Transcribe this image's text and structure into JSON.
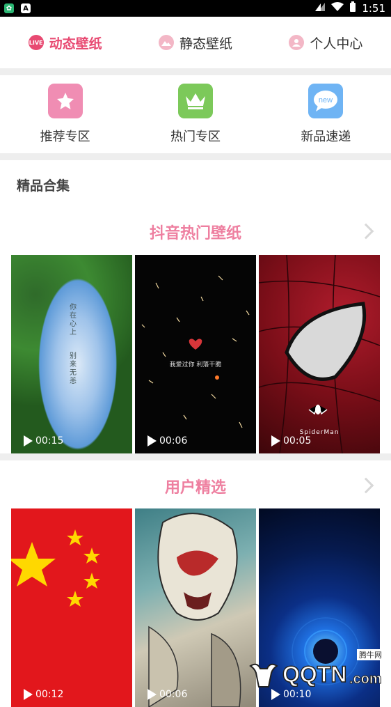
{
  "status": {
    "time": "1:51"
  },
  "tabs": [
    {
      "label": "动态壁纸",
      "icon": "live-icon",
      "badge": "LIVE"
    },
    {
      "label": "静态壁纸",
      "icon": "image-icon"
    },
    {
      "label": "个人中心",
      "icon": "user-icon"
    }
  ],
  "quick": [
    {
      "label": "推荐专区",
      "icon": "star-icon",
      "color": "#f08db3"
    },
    {
      "label": "热门专区",
      "icon": "crown-icon",
      "color": "#7cc95a"
    },
    {
      "label": "新品速递",
      "icon": "new-icon",
      "color": "#6fb4f4",
      "badge": "new"
    }
  ],
  "section_title": "精品合集",
  "categories": [
    {
      "title": "抖音热门壁纸",
      "items": [
        {
          "duration": "00:15",
          "caption_a": "你在心上",
          "caption_b": "别来无恙"
        },
        {
          "duration": "00:06",
          "caption": "我爱过你 利落干脆"
        },
        {
          "duration": "00:05",
          "brand": "SpiderMan"
        }
      ]
    },
    {
      "title": "用户精选",
      "items": [
        {
          "duration": "00:12"
        },
        {
          "duration": "00:06"
        },
        {
          "duration": "00:10"
        }
      ]
    }
  ],
  "watermark": {
    "brand": "QQTN",
    "suffix": ".com",
    "tag": "腾牛网"
  }
}
